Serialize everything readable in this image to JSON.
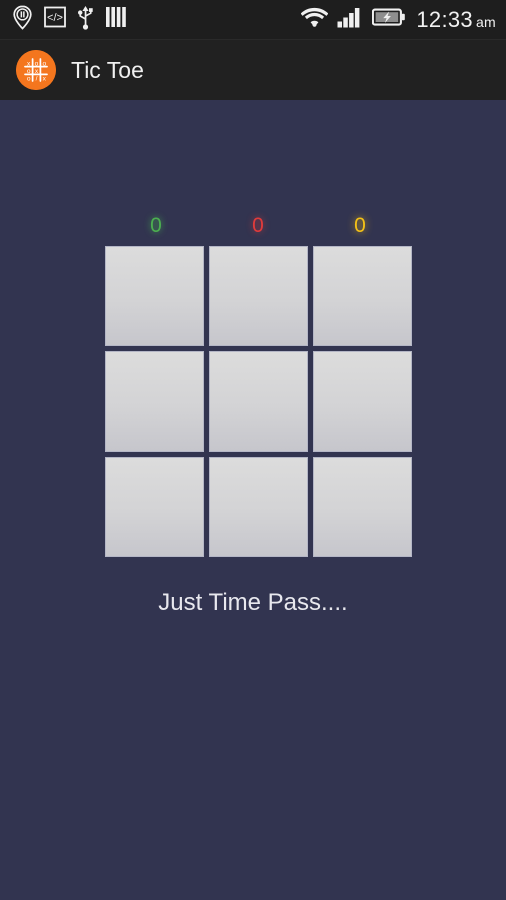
{
  "status_bar": {
    "icons_left": [
      {
        "name": "location-pause-icon",
        "label": "location-pause"
      },
      {
        "name": "developer-options-icon",
        "label": "</>"
      },
      {
        "name": "usb-icon",
        "label": "usb"
      },
      {
        "name": "vibrate-bars-icon",
        "label": "bars"
      }
    ],
    "icons_right": [
      {
        "name": "wifi-icon",
        "label": "wifi"
      },
      {
        "name": "signal-bars-icon",
        "label": "signal"
      },
      {
        "name": "battery-charging-icon",
        "label": "battery-charging"
      }
    ],
    "time": "12:33",
    "ampm": "am"
  },
  "action_bar": {
    "app_title": "Tic Toe",
    "logo_marks": [
      "x",
      "o",
      "o",
      "o",
      "x",
      "",
      "",
      "o",
      "x"
    ]
  },
  "scores": [
    {
      "name": "player-x-score",
      "value": "0",
      "color": "#4caf50"
    },
    {
      "name": "draw-score",
      "value": "0",
      "color": "#e03b3b"
    },
    {
      "name": "player-o-score",
      "value": "0",
      "color": "#f4c117"
    }
  ],
  "board": {
    "cells": [
      "",
      "",
      "",
      "",
      "",
      "",
      "",
      "",
      ""
    ]
  },
  "tagline": "Just Time Pass...."
}
